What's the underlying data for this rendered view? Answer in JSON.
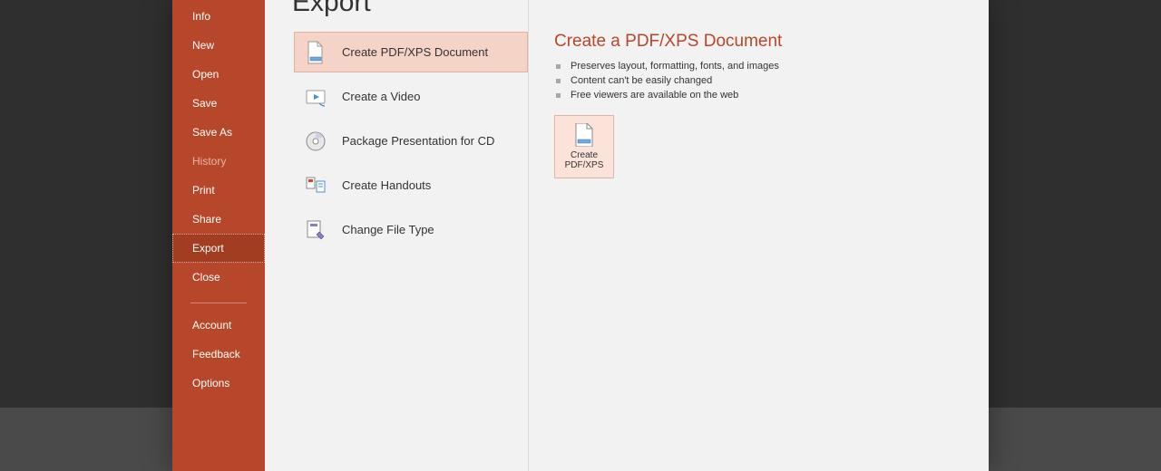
{
  "page_title": "Export",
  "sidebar": {
    "items": [
      {
        "label": "Info",
        "state": "normal"
      },
      {
        "label": "New",
        "state": "normal"
      },
      {
        "label": "Open",
        "state": "normal"
      },
      {
        "label": "Save",
        "state": "normal"
      },
      {
        "label": "Save As",
        "state": "normal"
      },
      {
        "label": "History",
        "state": "dim"
      },
      {
        "label": "Print",
        "state": "normal"
      },
      {
        "label": "Share",
        "state": "normal"
      },
      {
        "label": "Export",
        "state": "selected"
      },
      {
        "label": "Close",
        "state": "normal"
      }
    ],
    "secondary": [
      {
        "label": "Account"
      },
      {
        "label": "Feedback"
      },
      {
        "label": "Options"
      }
    ]
  },
  "export_options": [
    {
      "label": "Create PDF/XPS Document",
      "icon": "pdf",
      "selected": true
    },
    {
      "label": "Create a Video",
      "icon": "video",
      "selected": false
    },
    {
      "label": "Package Presentation for CD",
      "icon": "cd",
      "selected": false
    },
    {
      "label": "Create Handouts",
      "icon": "handout",
      "selected": false
    },
    {
      "label": "Change File Type",
      "icon": "change",
      "selected": false
    }
  ],
  "detail": {
    "title": "Create a PDF/XPS Document",
    "bullets": [
      "Preserves layout, formatting, fonts, and images",
      "Content can't be easily changed",
      "Free viewers are available on the web"
    ],
    "button_line1": "Create",
    "button_line2": "PDF/XPS"
  },
  "colors": {
    "accent": "#b7472a",
    "accent_dark": "#a33d22",
    "selection_fill": "#f5d3c6",
    "selection_border": "#e2b39f",
    "page_bg": "#f2f2f2"
  }
}
